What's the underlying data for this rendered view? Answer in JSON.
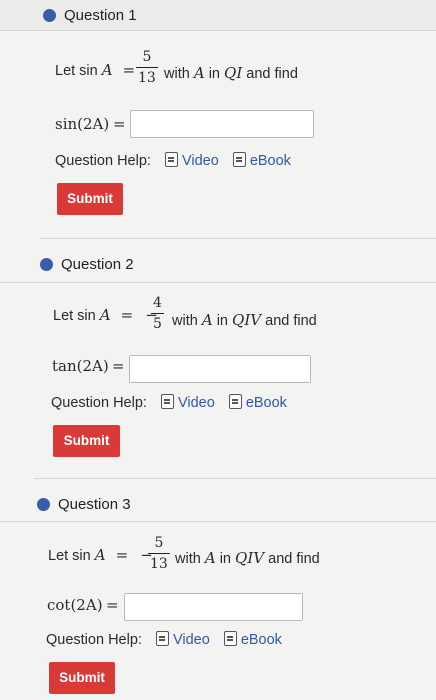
{
  "question_help_label": "Question Help:",
  "video_label": "Video",
  "ebook_label": "eBook",
  "submit_label": "Submit",
  "questions": [
    {
      "title": "Question 1",
      "prompt_prefix": "Let sin",
      "var": "A",
      "equals": "=",
      "sign": "",
      "numerator": "5",
      "denominator": "13",
      "with_text": "with",
      "in_text": "in",
      "quadrant": "QI",
      "find_text": "and find",
      "func": "sin(2A)",
      "answer_value": ""
    },
    {
      "title": "Question 2",
      "prompt_prefix": "Let sin",
      "var": "A",
      "equals": "=",
      "sign": "−",
      "numerator": "4",
      "denominator": "5",
      "with_text": "with",
      "in_text": "in",
      "quadrant": "QIV",
      "find_text": "and find",
      "func": "tan(2A)",
      "answer_value": ""
    },
    {
      "title": "Question 3",
      "prompt_prefix": "Let sin",
      "var": "A",
      "equals": "=",
      "sign": "−",
      "numerator": "5",
      "denominator": "13",
      "with_text": "with",
      "in_text": "in",
      "quadrant": "QIV",
      "find_text": "and find",
      "func": "cot(2A)",
      "answer_value": ""
    }
  ]
}
